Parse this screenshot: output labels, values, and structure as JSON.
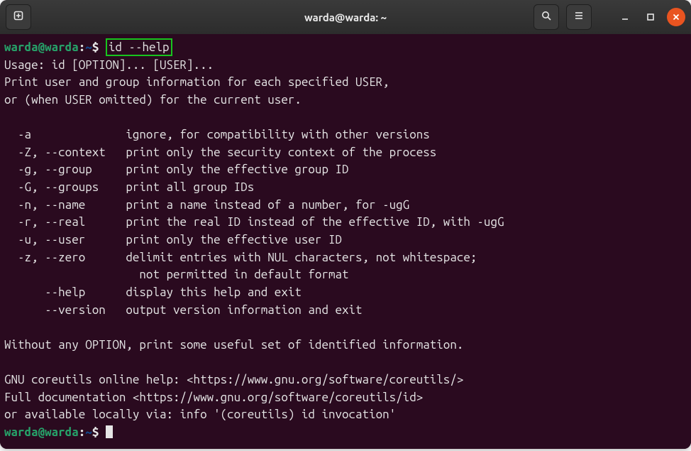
{
  "titlebar": {
    "title": "warda@warda: ~"
  },
  "prompt": {
    "userhost": "warda@warda",
    "path": "~",
    "symbol": "$"
  },
  "command1": {
    "text": "id --help"
  },
  "output": {
    "l01": "Usage: id [OPTION]... [USER]...",
    "l02": "Print user and group information for each specified USER,",
    "l03": "or (when USER omitted) for the current user.",
    "l04": "",
    "l05": "  -a              ignore, for compatibility with other versions",
    "l06": "  -Z, --context   print only the security context of the process",
    "l07": "  -g, --group     print only the effective group ID",
    "l08": "  -G, --groups    print all group IDs",
    "l09": "  -n, --name      print a name instead of a number, for -ugG",
    "l10": "  -r, --real      print the real ID instead of the effective ID, with -ugG",
    "l11": "  -u, --user      print only the effective user ID",
    "l12": "  -z, --zero      delimit entries with NUL characters, not whitespace;",
    "l13": "                    not permitted in default format",
    "l14": "      --help      display this help and exit",
    "l15": "      --version   output version information and exit",
    "l16": "",
    "l17": "Without any OPTION, print some useful set of identified information.",
    "l18": "",
    "l19": "GNU coreutils online help: <https://www.gnu.org/software/coreutils/>",
    "l20": "Full documentation <https://www.gnu.org/software/coreutils/id>",
    "l21": "or available locally via: info '(coreutils) id invocation'"
  }
}
